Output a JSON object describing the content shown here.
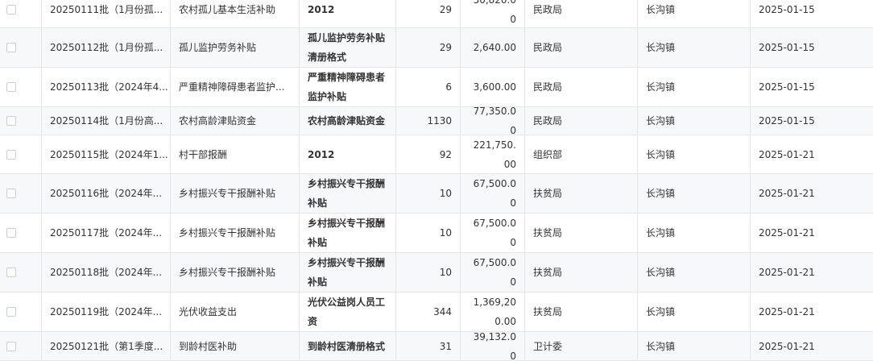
{
  "rows": [
    {
      "batch": "20250111批（1月份孤...",
      "name": "农村孤儿基本生活补助",
      "project": "2012",
      "count": "29",
      "amount": "50,820.00",
      "dept": "民政局",
      "town": "长沟镇",
      "date": "2025-01-15"
    },
    {
      "batch": "20250112批（1月份孤...",
      "name": "孤儿监护劳务补贴",
      "project": "孤儿监护劳务补贴清册格式",
      "count": "29",
      "amount": "2,640.00",
      "dept": "民政局",
      "town": "长沟镇",
      "date": "2025-01-15"
    },
    {
      "batch": "20250113批（2024年4...",
      "name": "严重精神障碍患者监护...",
      "project": "严重精神障碍患者监护补贴",
      "count": "6",
      "amount": "3,600.00",
      "dept": "民政局",
      "town": "长沟镇",
      "date": "2025-01-15"
    },
    {
      "batch": "20250114批（1月份高...",
      "name": "农村高龄津贴资金",
      "project": "农村高龄津贴资金",
      "count": "1130",
      "amount": "77,350.00",
      "dept": "民政局",
      "town": "长沟镇",
      "date": "2025-01-15"
    },
    {
      "batch": "20250115批（2024年1...",
      "name": "村干部报酬",
      "project": "2012",
      "count": "92",
      "amount": "221,750.00",
      "dept": "组织部",
      "town": "长沟镇",
      "date": "2025-01-21"
    },
    {
      "batch": "20250116批（2024年...",
      "name": "乡村振兴专干报酬补贴",
      "project": "乡村振兴专干报酬补贴",
      "count": "10",
      "amount": "67,500.00",
      "dept": "扶贫局",
      "town": "长沟镇",
      "date": "2025-01-21"
    },
    {
      "batch": "20250117批（2024年...",
      "name": "乡村振兴专干报酬补贴",
      "project": "乡村振兴专干报酬补贴",
      "count": "10",
      "amount": "67,500.00",
      "dept": "扶贫局",
      "town": "长沟镇",
      "date": "2025-01-21"
    },
    {
      "batch": "20250118批（2024年...",
      "name": "乡村振兴专干报酬补贴",
      "project": "乡村振兴专干报酬补贴",
      "count": "10",
      "amount": "67,500.00",
      "dept": "扶贫局",
      "town": "长沟镇",
      "date": "2025-01-21"
    },
    {
      "batch": "20250119批（2024年...",
      "name": "光伏收益支出",
      "project": "光伏公益岗人员工资",
      "count": "344",
      "amount": "1,369,200.00",
      "dept": "扶贫局",
      "town": "长沟镇",
      "date": "2025-01-21"
    },
    {
      "batch": "20250121批（第1季度...",
      "name": "到龄村医补助",
      "project": "到龄村医清册格式",
      "count": "31",
      "amount": "39,132.00",
      "dept": "卫计委",
      "town": "长沟镇",
      "date": "2025-01-21"
    }
  ]
}
